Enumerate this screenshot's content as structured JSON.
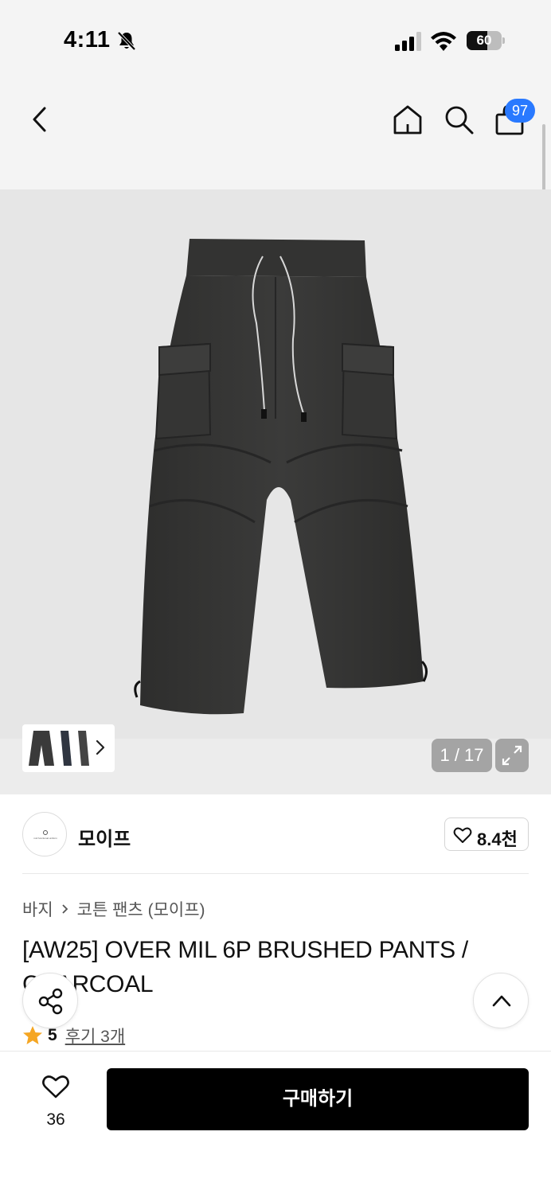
{
  "status_bar": {
    "time": "4:11",
    "battery_level": "60",
    "battery_fraction": 0.6
  },
  "header": {
    "back_icon": "chevron-left-icon",
    "home_icon": "home-icon",
    "search_icon": "search-icon",
    "cart_icon": "shopping-bag-icon",
    "cart_badge": "97",
    "badge_color": "#2979ff"
  },
  "gallery": {
    "page_counter": "1 / 17",
    "expand_icon": "expand-icon",
    "thumbnail_chevron_icon": "chevron-right-icon"
  },
  "brand": {
    "name": "모이프",
    "logo_text": "mof functional uniform",
    "likes": "8.4천"
  },
  "product": {
    "breadcrumb": [
      "바지",
      "코튼 팬츠 (모이프)"
    ],
    "title": "[AW25] OVER MIL 6P BRUSHED PANTS / CHARCOAL",
    "rating": "5",
    "review_link": "후기 3개",
    "star_color": "#f5a623"
  },
  "actions": {
    "share_icon": "share-icon",
    "scroll_top_icon": "chevron-up-icon"
  },
  "bottom_bar": {
    "wish_count": "36",
    "buy_label": "구매하기"
  }
}
